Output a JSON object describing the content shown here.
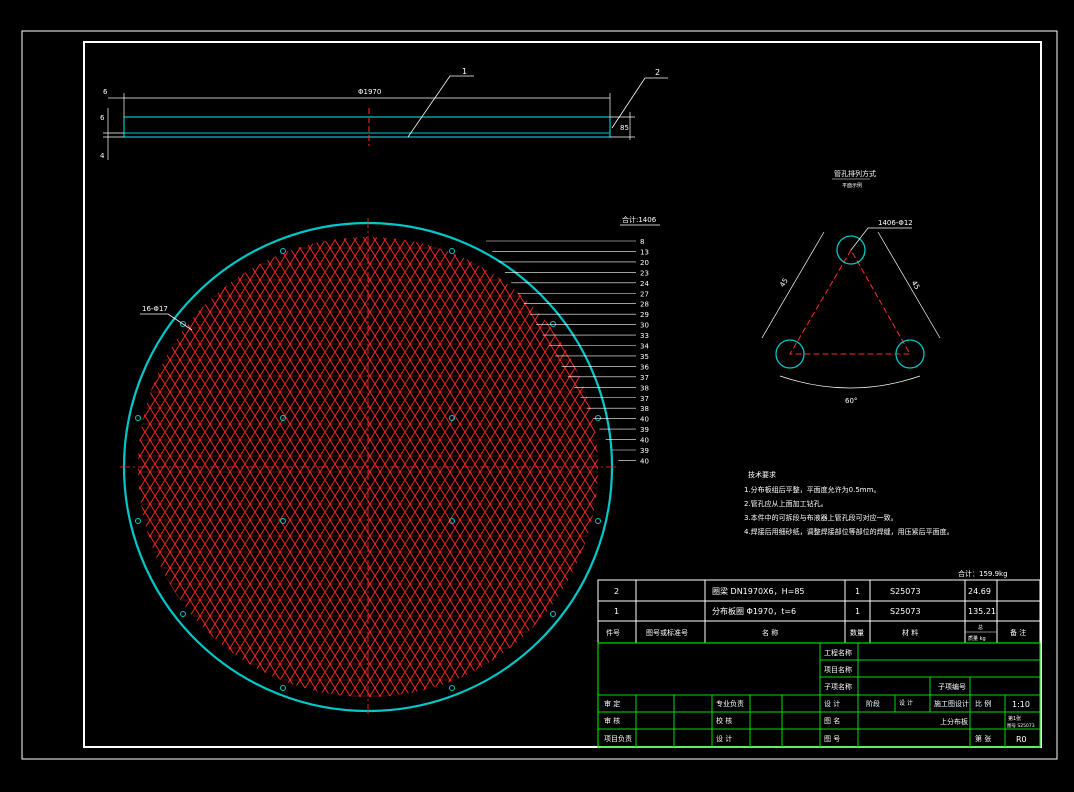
{
  "colors": {
    "background": "#000000",
    "frame": "#ffffff",
    "plate": "#00c8c8",
    "holes": "#ff2a2a",
    "title_block": "#00dd00"
  },
  "side_view": {
    "dim_total": "Φ1970",
    "dim_left": "6",
    "dim_thk1": "6",
    "dim_thk2": "4",
    "dim_right": "85",
    "callout_1": "1",
    "callout_2": "2"
  },
  "plan_view": {
    "hole_callout": "16-Φ17",
    "hole_count_title": "合计:1406",
    "row_counts": [
      "8",
      "13",
      "20",
      "23",
      "24",
      "27",
      "28",
      "29",
      "30",
      "33",
      "34",
      "35",
      "36",
      "37",
      "38",
      "37",
      "38",
      "40",
      "39",
      "40",
      "39",
      "40"
    ]
  },
  "hole_detail": {
    "title": "管孔排列方式",
    "subtitle": "平面示例",
    "callout": "1406-Φ12",
    "dim_left": "45",
    "dim_right": "45",
    "angle": "60°"
  },
  "notes": {
    "title": "技术要求",
    "lines": [
      "1.分布板组后平整，平面度允许为0.5mm。",
      "2.管孔应从上面加工钻孔。",
      "3.本件中的可拆段与布液器上管孔段可对应一致。",
      "4.焊接后用细砂纸，调整焊接部位等部位的焊缝，用压紧后平面度。"
    ],
    "total_weight": "合计：159.9kg"
  },
  "bom": {
    "rows": [
      {
        "no": "2",
        "drawing": "",
        "name": "圈梁 DN1970X6，H=85",
        "qty": "1",
        "material": "S25073",
        "weight": "24.69",
        "remark": ""
      },
      {
        "no": "1",
        "drawing": "",
        "name": "分布板圈 Φ1970，t=6",
        "qty": "1",
        "material": "S25073",
        "weight": "135.21",
        "remark": ""
      }
    ],
    "headers": {
      "no": "件号",
      "drawing": "图号或标准号",
      "name": "名 称",
      "qty": "数量",
      "material": "材 料",
      "weight_top": "总",
      "weight_unit": "质量 kg",
      "remark": "备 注"
    }
  },
  "title_block": {
    "project": "工程名称",
    "item": "项目名称",
    "subitem": "子项名称",
    "subitem_no": "子项编号",
    "review1": "审 定",
    "review2": "审 核",
    "pm": "项目负责",
    "spec_lead": "专业负责",
    "check": "校 核",
    "design": "设 计",
    "designer": "设 计",
    "drawing_name": "图 名",
    "drawing_no": "图 号",
    "stage_label": "设 计",
    "stage_value": "阶段",
    "stage2": "施工图设计",
    "scale_label": "比 例",
    "scale": "1:10",
    "part": "上分布板",
    "sheet_info": "第1张",
    "sheet_code": "图号 S25073",
    "page": "第 张",
    "rev": "R0"
  }
}
